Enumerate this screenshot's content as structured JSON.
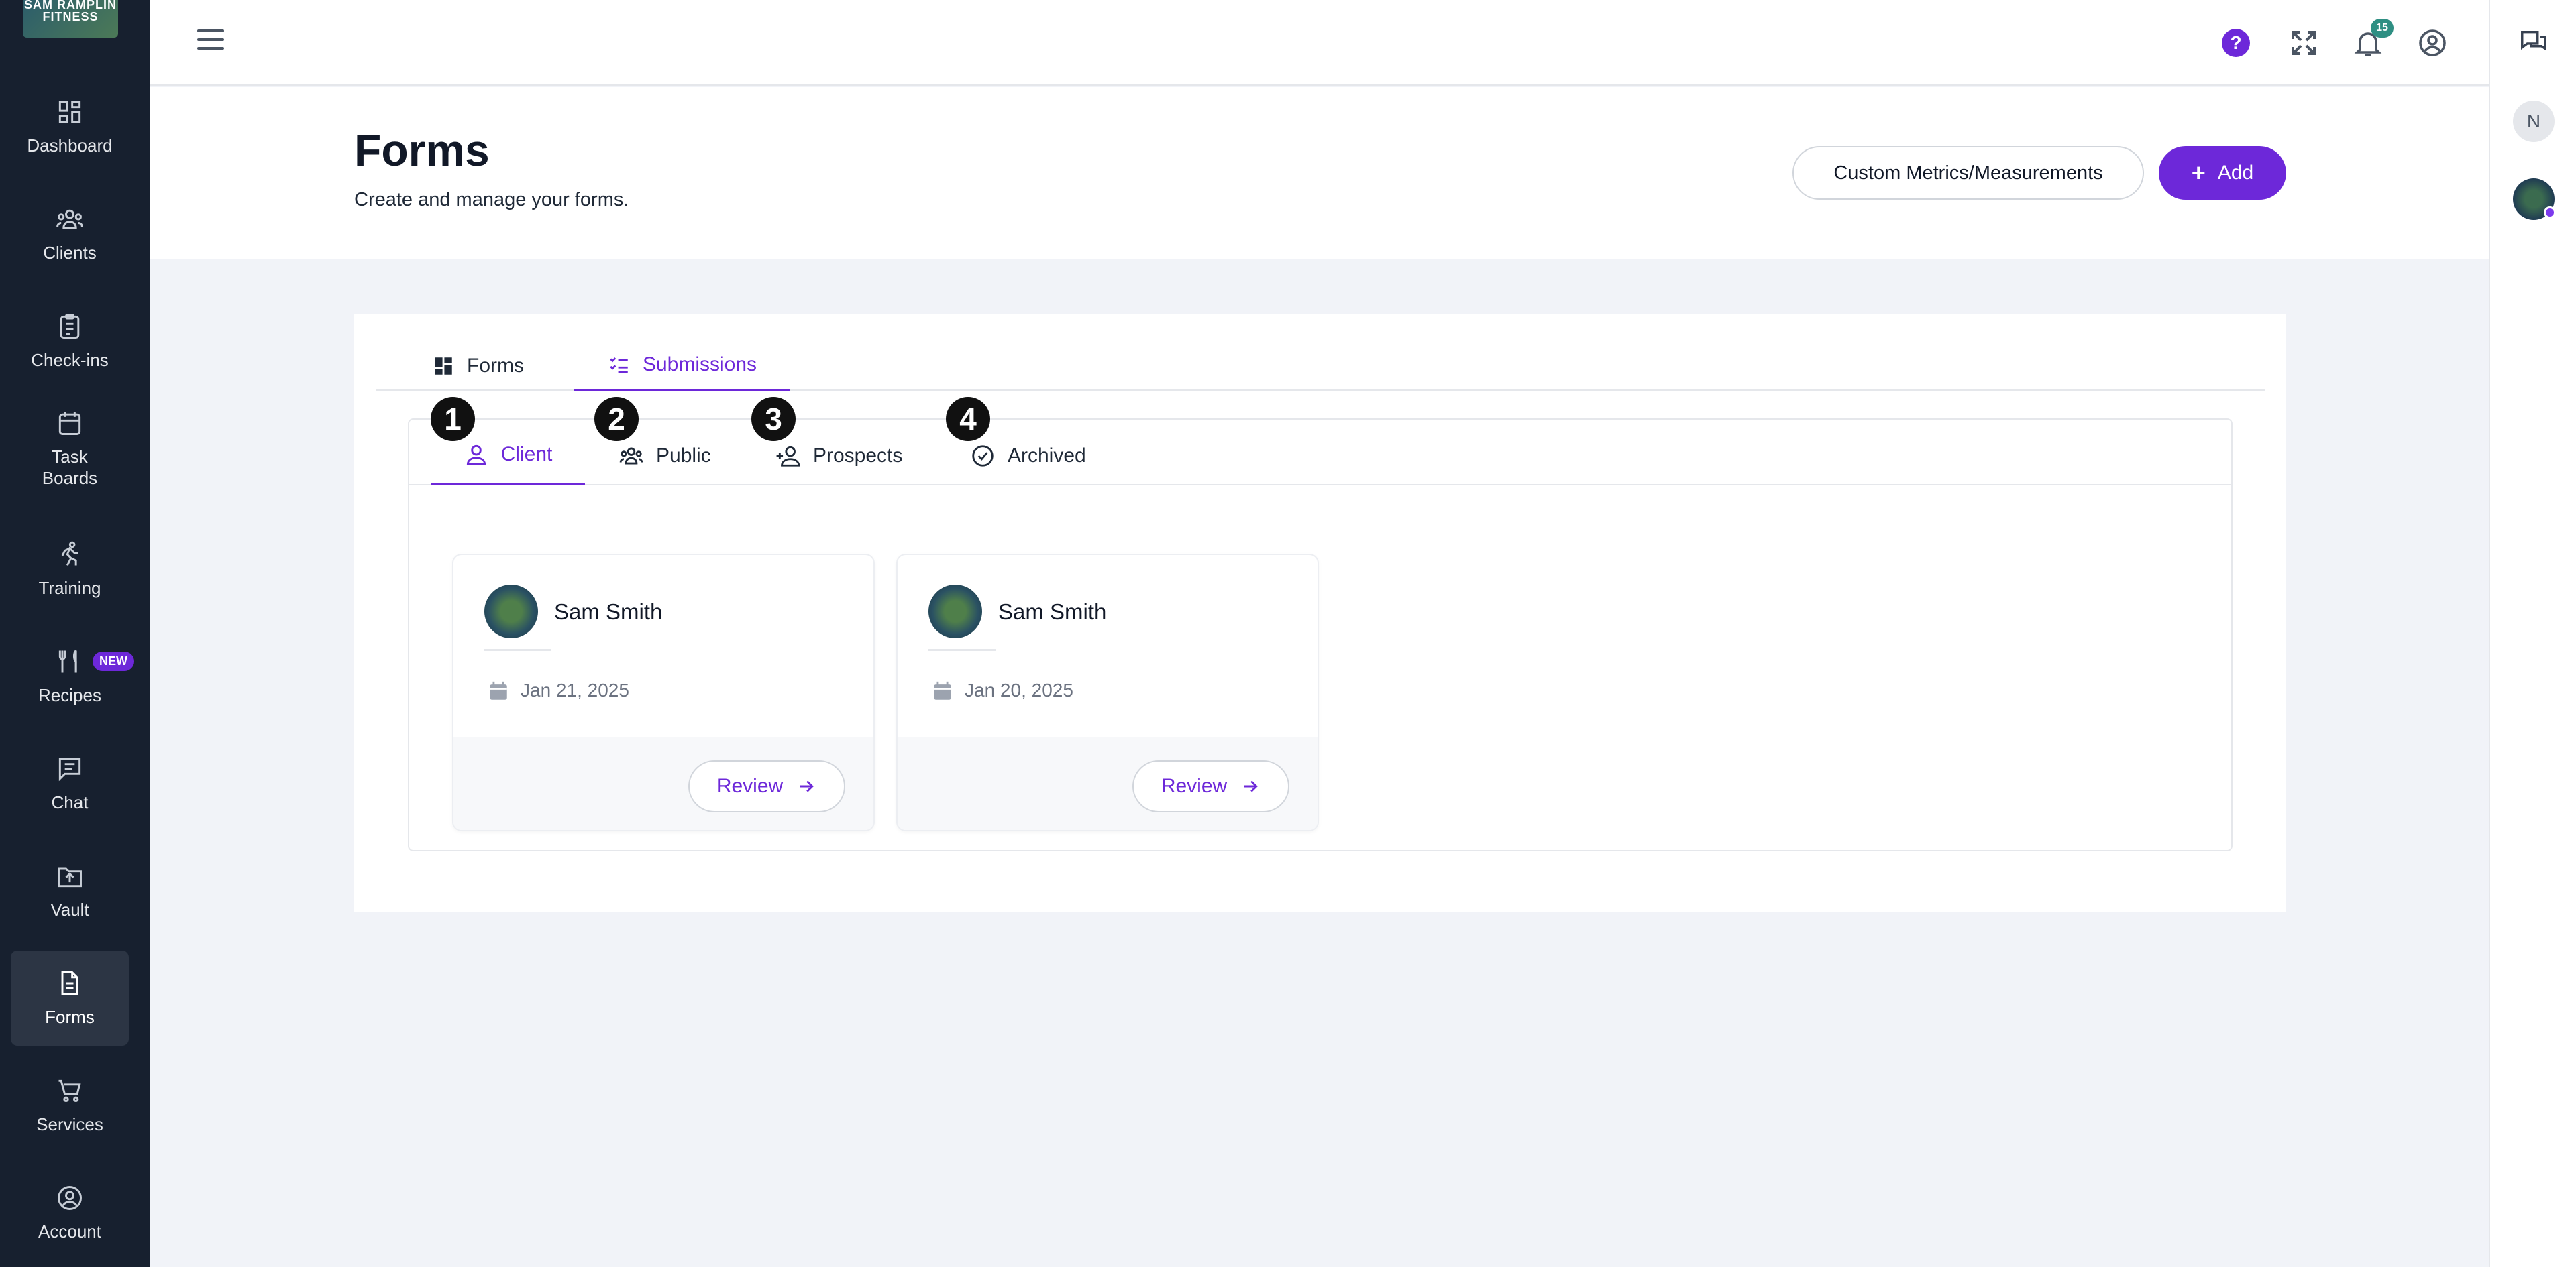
{
  "app": {
    "logo_text": "SAM RAMPLIN FITNESS"
  },
  "sidebar": {
    "items": [
      {
        "label": "Dashboard",
        "icon": "dashboard-icon"
      },
      {
        "label": "Clients",
        "icon": "clients-icon"
      },
      {
        "label": "Check-ins",
        "icon": "clipboard-icon"
      },
      {
        "label": "Task Boards",
        "icon": "calendar-icon"
      },
      {
        "label": "Training",
        "icon": "running-icon"
      },
      {
        "label": "Recipes",
        "icon": "utensils-icon",
        "badge": "NEW"
      },
      {
        "label": "Chat",
        "icon": "chat-icon"
      },
      {
        "label": "Vault",
        "icon": "upload-folder-icon"
      },
      {
        "label": "Forms",
        "icon": "document-icon",
        "active": true
      },
      {
        "label": "Services",
        "icon": "cart-icon"
      },
      {
        "label": "Account",
        "icon": "user-circle-icon"
      }
    ]
  },
  "topbar": {
    "help_label": "?",
    "notifications_count": "15"
  },
  "right_rail": {
    "initial": "N"
  },
  "header": {
    "title": "Forms",
    "subtitle": "Create and manage your forms.",
    "custom_metrics_label": "Custom Metrics/Measurements",
    "add_label": "Add"
  },
  "tabs": [
    {
      "label": "Forms",
      "active": false
    },
    {
      "label": "Submissions",
      "active": true
    }
  ],
  "subtabs": [
    {
      "label": "Client",
      "number": "1",
      "active": true
    },
    {
      "label": "Public",
      "number": "2"
    },
    {
      "label": "Prospects",
      "number": "3"
    },
    {
      "label": "Archived",
      "number": "4"
    }
  ],
  "submissions": [
    {
      "name": "Sam Smith",
      "date": "Jan 21, 2025",
      "action": "Review"
    },
    {
      "name": "Sam Smith",
      "date": "Jan 20, 2025",
      "action": "Review"
    }
  ],
  "colors": {
    "accent": "#6d28d9",
    "sidebar_bg": "#17202f",
    "badge_teal": "#2f8f83"
  }
}
